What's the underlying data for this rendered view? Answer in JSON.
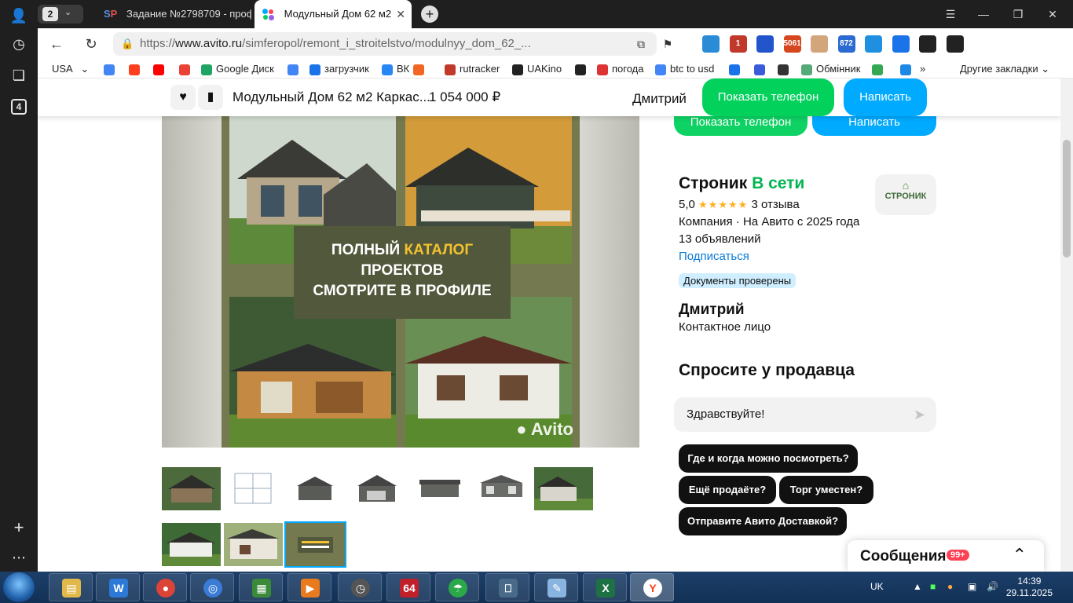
{
  "browser": {
    "tab_count": "2",
    "tabs": [
      {
        "favicon": "SP",
        "title": "Задание №2798709 - проф"
      },
      {
        "title": "Модульный Дом 62 м2"
      }
    ],
    "url_host": "www.avito.ru",
    "url_scheme": "https://",
    "url_path": "/simferopol/remont_i_stroitelstvo/modulnyy_dom_62_...",
    "extensions": [
      {
        "label": "",
        "color": "#2a8bd6"
      },
      {
        "label": "1",
        "color": "#c0392b"
      },
      {
        "label": "",
        "color": "#2255cc"
      },
      {
        "label": "5061",
        "color": "#d6461f"
      },
      {
        "label": "",
        "color": "#d3a57a"
      },
      {
        "label": "872",
        "color": "#2b6bd1"
      },
      {
        "label": "",
        "color": "#1f8fe0"
      },
      {
        "label": "",
        "color": "#1a73e8"
      },
      {
        "label": "",
        "color": "#222222"
      },
      {
        "label": "",
        "color": "#222222"
      }
    ],
    "bookmarks": [
      {
        "label": "USA",
        "icon": "chevron-down-icon"
      },
      {
        "label": "",
        "icon": "google-icon"
      },
      {
        "label": "",
        "icon": "yandex-icon"
      },
      {
        "label": "",
        "icon": "youtube-icon"
      },
      {
        "label": "",
        "icon": "gmail-icon"
      },
      {
        "label": "Google Диск",
        "icon": "drive-icon"
      },
      {
        "label": "",
        "icon": "translate-icon"
      },
      {
        "label": "загрузчик",
        "icon": "loop-icon"
      },
      {
        "label": "ВК",
        "icon": "vk-icon"
      },
      {
        "label": "",
        "icon": "f-icon"
      },
      {
        "label": "rutracker",
        "icon": "rutracker-icon"
      },
      {
        "label": "UAKino",
        "icon": "uakino-icon"
      },
      {
        "label": "",
        "icon": "figure-icon"
      },
      {
        "label": "погода",
        "icon": "thermometer-icon"
      },
      {
        "label": "btc to usd",
        "icon": "google-icon"
      },
      {
        "label": "",
        "icon": "p-icon"
      },
      {
        "label": "",
        "icon": "arrow-icon"
      },
      {
        "label": "",
        "icon": "bc-icon"
      },
      {
        "label": "Обмінник",
        "icon": "diamond-icon"
      },
      {
        "label": "",
        "icon": "maps-icon"
      },
      {
        "label": "",
        "icon": "star-icon"
      }
    ],
    "bookmarks_more": "»",
    "other_bookmarks": "Другие закладки",
    "sidebar_badge": "4"
  },
  "sticky_header": {
    "title": "Модульный Дом 62 м2 Каркас...",
    "price": "1 054 000 ₽",
    "seller": "Дмитрий",
    "show_phone": "Показать телефон",
    "write": "Написать"
  },
  "gallery": {
    "banner_line1_a": "ПОЛНЫЙ",
    "banner_line1_b": "КАТАЛОГ",
    "banner_line2": "ПРОЕКТОВ",
    "banner_line3": "СМОТРИТЕ В ПРОФИЛЕ",
    "watermark": "Avito",
    "thumb_count": 10,
    "selected_thumb": 10
  },
  "seller": {
    "name": "Строник",
    "status": "В сети",
    "rating": "5,0",
    "stars": 5,
    "reviews": "3 отзыва",
    "company": "Компания · На Авито с 2025 года",
    "listings": "13 объявлений",
    "subscribe": "Подписаться",
    "verified": "Документы проверены",
    "logo_text": "СТРОНИК",
    "contact_name": "Дмитрий",
    "contact_role": "Контактное лицо"
  },
  "ask": {
    "heading": "Спросите у продавца",
    "input_value": "Здравствуйте!",
    "chips": [
      "Где и когда можно посмотреть?",
      "Ещё продаёте?",
      "Торг уместен?",
      "Отправите Авито Доставкой?"
    ]
  },
  "messages": {
    "label": "Сообщения",
    "badge": "99+"
  },
  "taskbar": {
    "lang": "UK",
    "time": "14:39",
    "date": "29.11.2025",
    "app64": "64"
  },
  "colors": {
    "avito_green": "#02d15c",
    "avito_blue": "#00aaff",
    "online_green": "#02b551",
    "link_blue": "#0a7bd8"
  }
}
